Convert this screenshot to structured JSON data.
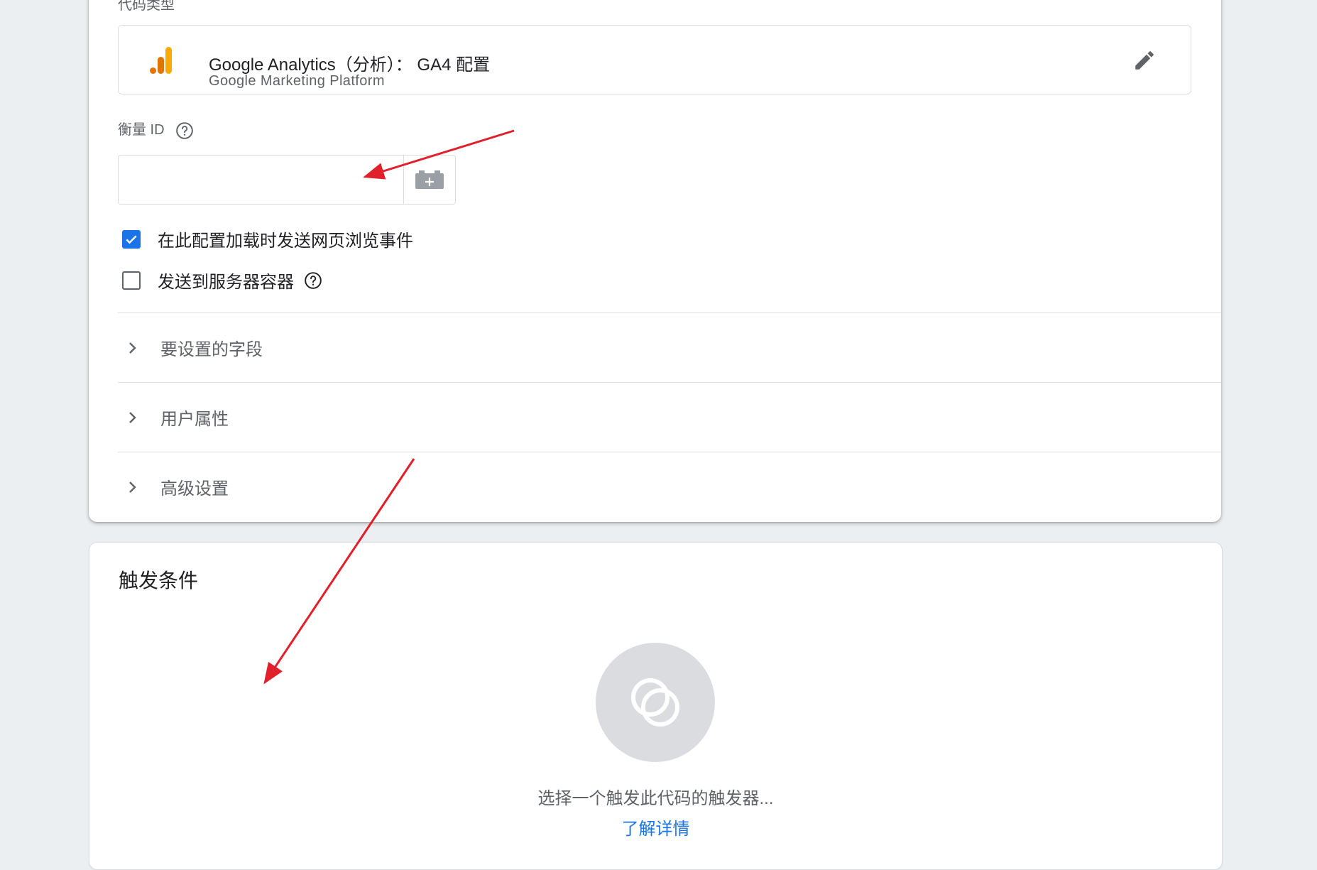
{
  "config": {
    "tag_type_label": "代码类型",
    "tag_type": {
      "title": "Google Analytics（分析）： GA4 配置",
      "subtitle": "Google Marketing Platform",
      "icon": "google-analytics-icon"
    },
    "measurement_id": {
      "label": "衡量 ID",
      "value": "",
      "placeholder": ""
    },
    "checkboxes": [
      {
        "label": "在此配置加载时发送网页浏览事件",
        "checked": true
      },
      {
        "label": "发送到服务器容器",
        "checked": false
      }
    ],
    "expanders": [
      {
        "label": "要设置的字段"
      },
      {
        "label": "用户属性"
      },
      {
        "label": "高级设置"
      }
    ]
  },
  "triggering": {
    "title": "触发条件",
    "hint": "选择一个触发此代码的触发器...",
    "learn_more": "了解详情"
  },
  "colors": {
    "accent": "#1a73e8",
    "annotation_arrow": "#e0202a",
    "ga_orange": "#f9ab00",
    "ga_dark_orange": "#e37400"
  }
}
